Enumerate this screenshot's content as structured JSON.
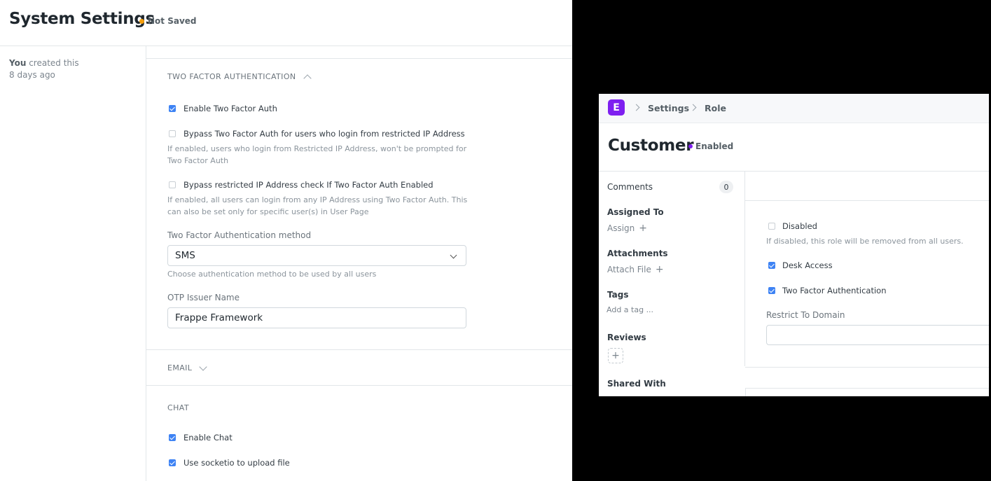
{
  "system_settings": {
    "title": "System Settings",
    "status": "Not Saved",
    "status_color": "#f59e0b",
    "created_by": "You",
    "created_text": "created this",
    "created_ago": "8 days ago",
    "two_factor": {
      "heading": "TWO FACTOR AUTHENTICATION",
      "enable_label": "Enable Two Factor Auth",
      "enable_checked": true,
      "bypass_label": "Bypass Two Factor Auth for users who login from restricted IP Address",
      "bypass_checked": false,
      "bypass_desc_1": "If enabled, users who login from Restricted IP Address, won't be prompted for",
      "bypass_desc_2": "Two Factor Auth",
      "bypass_ip_label": "Bypass restricted IP Address check If Two Factor Auth Enabled",
      "bypass_ip_checked": false,
      "bypass_ip_desc_1": "If enabled, all users can login from any IP Address using Two Factor Auth. This",
      "bypass_ip_desc_2": "can also be set only for specific user(s) in User Page",
      "method_label": "Two Factor Authentication method",
      "method_value": "SMS",
      "method_desc": "Choose authentication method to be used by all users",
      "otp_label": "OTP Issuer Name",
      "otp_value": "Frappe Framework"
    },
    "email_heading": "EMAIL",
    "chat": {
      "heading": "CHAT",
      "enable_label": "Enable Chat",
      "enable_checked": true,
      "socketio_label": "Use socketio to upload file",
      "socketio_checked": true
    }
  },
  "role_window": {
    "logo_letter": "E",
    "brand_color": "#7e1ff0",
    "breadcrumbs": [
      "Settings",
      "Role"
    ],
    "title": "Customer",
    "status": "Enabled",
    "status_color": "#7e1ff0",
    "sidebar": {
      "comments_label": "Comments",
      "comments_count": "0",
      "assigned_heading": "Assigned To",
      "assign_link": "Assign",
      "attachments_heading": "Attachments",
      "attach_link": "Attach File",
      "tags_heading": "Tags",
      "add_tag_link": "Add a tag ...",
      "reviews_heading": "Reviews",
      "shared_heading": "Shared With"
    },
    "form": {
      "disabled_label": "Disabled",
      "disabled_checked": false,
      "disabled_desc": "If disabled, this role will be removed from all users.",
      "desk_access_label": "Desk Access",
      "desk_access_checked": true,
      "two_factor_label": "Two Factor Authentication",
      "two_factor_checked": true,
      "restrict_domain_label": "Restrict To Domain",
      "restrict_domain_value": ""
    }
  }
}
